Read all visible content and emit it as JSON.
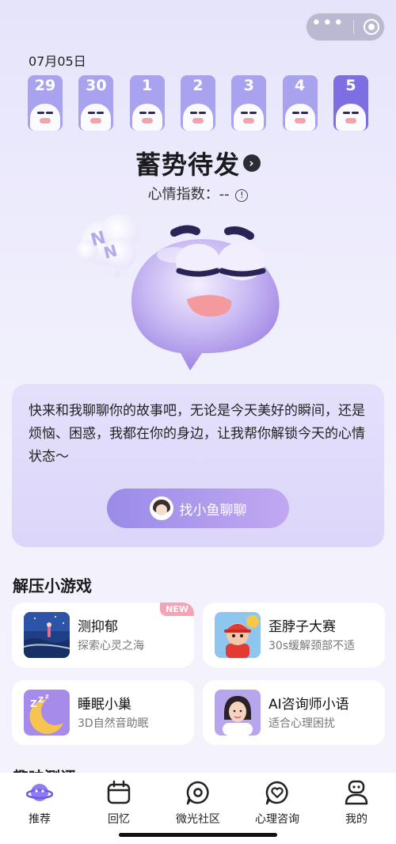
{
  "date": "07月05日",
  "days": [
    {
      "num": "29",
      "active": false
    },
    {
      "num": "30",
      "active": false
    },
    {
      "num": "1",
      "active": false
    },
    {
      "num": "2",
      "active": false
    },
    {
      "num": "3",
      "active": false
    },
    {
      "num": "4",
      "active": false
    },
    {
      "num": "5",
      "active": true
    }
  ],
  "mood": {
    "title": "蓄势待发",
    "index_label": "心情指数：--"
  },
  "chat": {
    "text": "快来和我聊聊你的故事吧，无论是今天美好的瞬间，还是烦恼、困惑，我都在你的身边，让我帮你解锁今天的心情状态～",
    "button": "找小鱼聊聊"
  },
  "games_section": "解压小游戏",
  "games": [
    {
      "title": "测抑郁",
      "subtitle": "探索心灵之海",
      "badge": "NEW"
    },
    {
      "title": "歪脖子大赛",
      "subtitle": "30s缓解颈部不适",
      "badge": ""
    },
    {
      "title": "睡眠小巢",
      "subtitle": "3D自然音助眠",
      "badge": ""
    },
    {
      "title": "AI咨询师小语",
      "subtitle": "适合心理困扰",
      "badge": ""
    }
  ],
  "next_section": "趣味测评",
  "tabs": [
    {
      "label": "推荐",
      "icon": "planet-icon"
    },
    {
      "label": "回忆",
      "icon": "calendar-icon"
    },
    {
      "label": "微光社区",
      "icon": "chat-circle-icon"
    },
    {
      "label": "心理咨询",
      "icon": "heart-chat-icon"
    },
    {
      "label": "我的",
      "icon": "robot-profile-icon"
    }
  ],
  "colors": {
    "accent": "#7d6fe2",
    "day_inactive": "#a9a2ee",
    "button_gradient_start": "#9a8be8",
    "button_gradient_end": "#c2a8f1",
    "badge": "#f6a3b5"
  }
}
